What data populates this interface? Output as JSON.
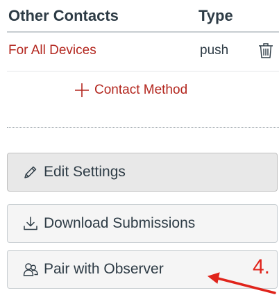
{
  "contacts": {
    "headers": {
      "other_contacts": "Other Contacts",
      "type": "Type"
    },
    "rows": [
      {
        "name": "For All Devices",
        "type": "push",
        "action_icon": "trash-icon"
      }
    ],
    "add_label": "Contact Method"
  },
  "buttons": {
    "edit_settings": "Edit Settings",
    "download_submissions": "Download Submissions",
    "pair_with_observer": "Pair with Observer"
  },
  "annotation": {
    "number": "4."
  },
  "colors": {
    "link": "#b3261e",
    "text": "#2d3b45",
    "annotation": "#e0241b"
  },
  "icons": {
    "delete": "trash-icon",
    "add": "plus-icon",
    "edit": "pencil-icon",
    "download": "download-icon",
    "pair": "users-icon"
  }
}
